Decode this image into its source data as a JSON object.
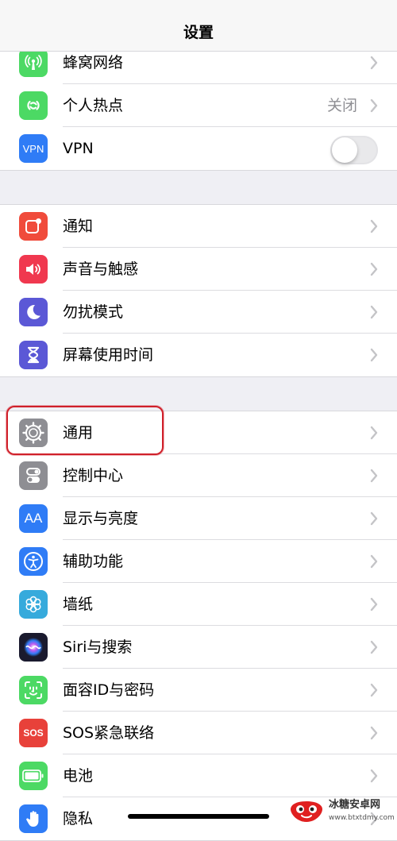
{
  "nav": {
    "title": "设置"
  },
  "section1": {
    "cellular_label": "蜂窝网络",
    "hotspot_label": "个人热点",
    "hotspot_value": "关闭",
    "vpn_label": "VPN",
    "vpn_icon_text": "VPN",
    "vpn_enabled": false
  },
  "section2": {
    "notifications_label": "通知",
    "sounds_label": "声音与触感",
    "dnd_label": "勿扰模式",
    "screentime_label": "屏幕使用时间"
  },
  "section3": {
    "general_label": "通用",
    "control_label": "控制中心",
    "display_label": "显示与亮度",
    "display_icon_text": "AA",
    "accessibility_label": "辅助功能",
    "wallpaper_label": "墙纸",
    "siri_label": "Siri与搜索",
    "faceid_label": "面容ID与密码",
    "sos_label": "SOS紧急联络",
    "sos_icon_text": "SOS",
    "battery_label": "电池",
    "privacy_label": "隐私"
  },
  "watermark": {
    "name": "冰糖安卓网",
    "url": "www.btxtdmy.com"
  },
  "colors": {
    "cellular": "#4cd964",
    "hotspot": "#4cd964",
    "vpn": "#2f7cf6",
    "notifications": "#f04b3b",
    "sounds": "#f0384f",
    "dnd": "#5b58d6",
    "screentime": "#5b58d6",
    "general": "#8e8e93",
    "control": "#8e8e93",
    "display": "#2f7cf6",
    "accessibility": "#2f7cf6",
    "wallpaper": "#36aadc",
    "faceid": "#4cd964",
    "sos": "#e8413a",
    "battery": "#4cd964",
    "privacy": "#2f7cf6",
    "highlight": "#d0202a"
  }
}
